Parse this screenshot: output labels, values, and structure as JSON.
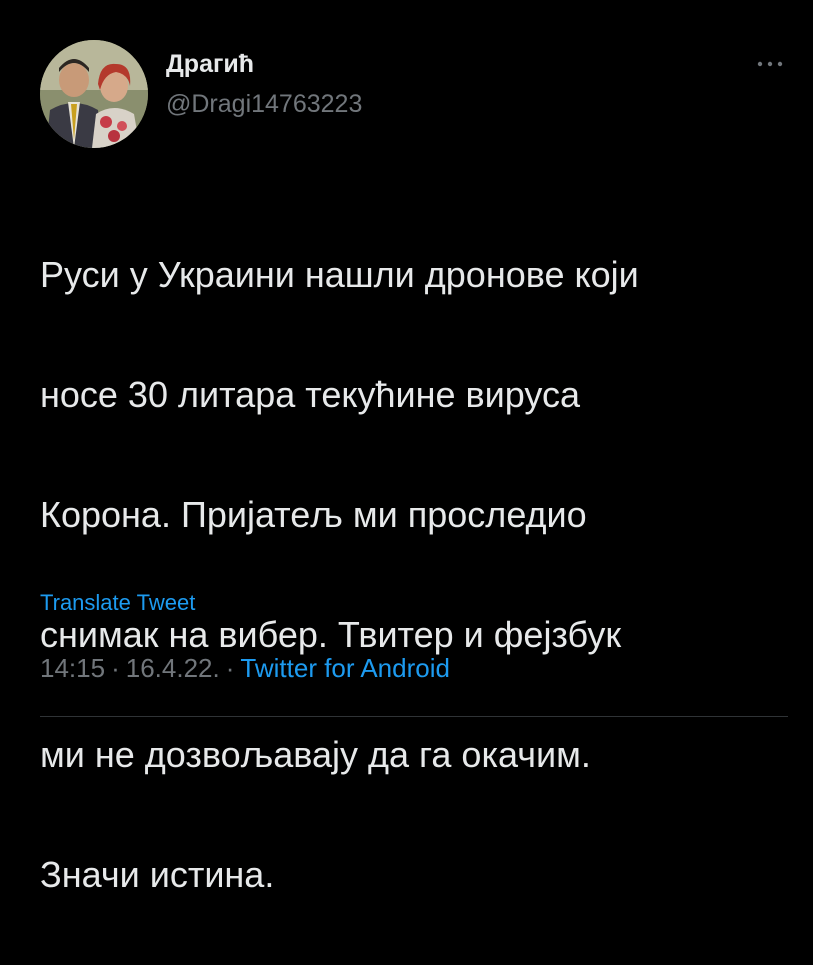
{
  "user": {
    "display_name": "Драгић",
    "handle": "@Dragi14763223",
    "avatar_icon": "profile-photo"
  },
  "tweet": {
    "text_lines": [
      "Руси у Украини нашли дронове који",
      "носе 30 литара текућине вируса",
      "Корона. Пријатељ ми проследио",
      "снимак на вибер. Твитер и фејзбук",
      "ми не дозвољавају да га окачим.",
      "Значи истина."
    ],
    "translate_label": "Translate Tweet",
    "time": "14:15",
    "date": "16.4.22.",
    "separator": "·",
    "source": "Twitter for Android"
  },
  "colors": {
    "background": "#000000",
    "text": "#e7e9ea",
    "secondary": "#71767b",
    "link": "#1d9bf0",
    "divider": "#2f3336"
  },
  "icons": {
    "more": "more-horizontal-icon"
  }
}
